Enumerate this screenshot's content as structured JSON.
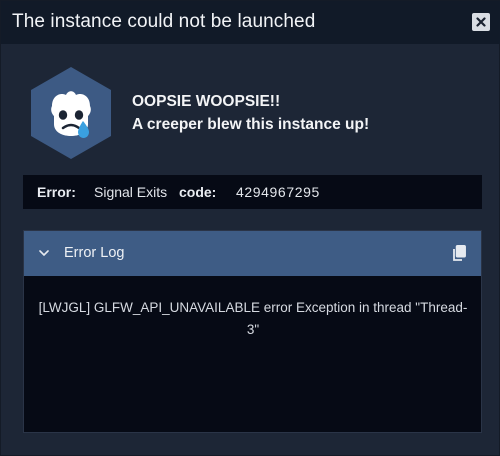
{
  "window": {
    "title": "The instance could not be launched",
    "close_icon": "close-icon"
  },
  "message": {
    "logo_icon": "sad-face-hexagon-icon",
    "line1": "OOPSIE WOOPSIE!!",
    "line2": "A creeper blew this instance up!"
  },
  "error": {
    "error_label": "Error:",
    "error_value": "Signal Exits",
    "code_label": "code:",
    "code_value": "4294967295"
  },
  "log": {
    "title": "Error Log",
    "toggle_icon": "chevron-down-icon",
    "copy_icon": "copy-icon",
    "text": "[LWJGL] GLFW_API_UNAVAILABLE error Exception in thread \"Thread-3\""
  },
  "colors": {
    "background": "#1d2636",
    "titlebar": "#111a28",
    "log_header": "#3e5c85",
    "panel": "#060a15",
    "logo_hex": "#3d5a84",
    "tear": "#3aa0e0"
  }
}
